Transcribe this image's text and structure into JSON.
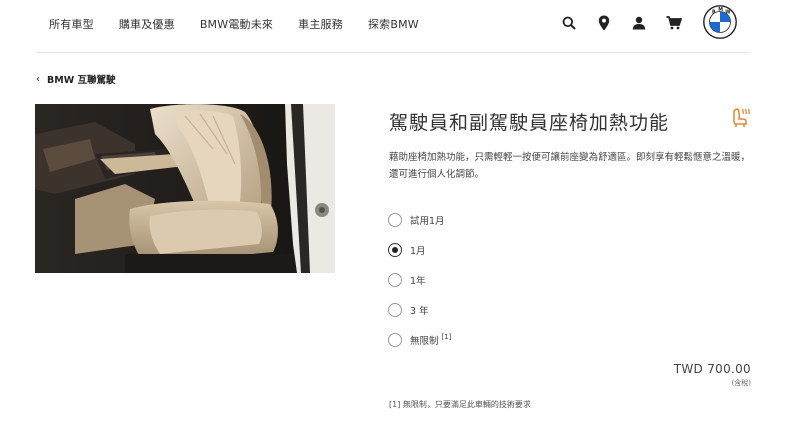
{
  "nav": {
    "links": [
      "所有車型",
      "購車及優惠",
      "BMW電動未來",
      "車主服務",
      "探索BMW"
    ]
  },
  "icons": {
    "search": "search-icon",
    "location": "location-pin-icon",
    "user": "user-icon",
    "cart": "cart-icon",
    "logo": "bmw-logo",
    "seat": "heated-seat-icon"
  },
  "back": {
    "chevron": "‹",
    "label": "BMW 互聯駕駛"
  },
  "product": {
    "title": "駕駛員和副駕駛員座椅加熱功能",
    "description": "藉助座椅加熱功能，只需輕輕一按便可讓前座變為舒適區。即刻享有輕鬆愜意之溫暖，還可進行個人化調節。",
    "options": [
      {
        "label": "試用1月",
        "checked": false,
        "note": ""
      },
      {
        "label": "1月",
        "checked": true,
        "note": ""
      },
      {
        "label": "1年",
        "checked": false,
        "note": ""
      },
      {
        "label": "3 年",
        "checked": false,
        "note": ""
      },
      {
        "label": "無限制",
        "checked": false,
        "note": "[1]"
      }
    ],
    "price": "TWD 700.00",
    "tax_note": "(含稅)",
    "footnote": "[1] 無限制，只要滿足此車輛的技術要求"
  },
  "colors": {
    "accent": "#e5862b",
    "text": "#262626",
    "divider": "#e6e6e6"
  }
}
